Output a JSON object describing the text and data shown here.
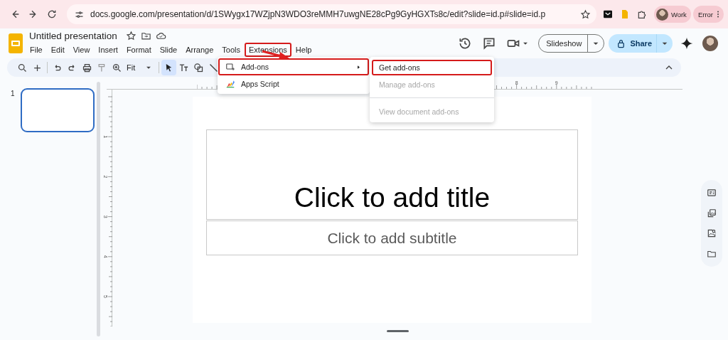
{
  "browser": {
    "url": "docs.google.com/presentation/d/1SWygx17WZjpN3WDO3reMMH7uwgNE28cPg9GyHGXTs8c/edit?slide=id.p#slide=id.p",
    "profile": "Work",
    "error_chip": "Error"
  },
  "document": {
    "title": "Untitled presentation"
  },
  "menu_bar": [
    {
      "label": "File",
      "highlighted": false
    },
    {
      "label": "Edit",
      "highlighted": false
    },
    {
      "label": "View",
      "highlighted": false
    },
    {
      "label": "Insert",
      "highlighted": false
    },
    {
      "label": "Format",
      "highlighted": false
    },
    {
      "label": "Slide",
      "highlighted": false
    },
    {
      "label": "Arrange",
      "highlighted": false
    },
    {
      "label": "Tools",
      "highlighted": false
    },
    {
      "label": "Extensions",
      "highlighted": true
    },
    {
      "label": "Help",
      "highlighted": false
    }
  ],
  "toolbar": {
    "zoom": "Fit",
    "tools": [
      {
        "kind": "select",
        "selected": true
      },
      {
        "kind": "text",
        "selected": false
      },
      {
        "kind": "shape",
        "selected": false
      },
      {
        "kind": "line",
        "selected": false
      }
    ]
  },
  "actions": {
    "slideshow": "Slideshow",
    "share": "Share"
  },
  "extensions_menu": [
    {
      "label": "Add-ons",
      "has_submenu": true,
      "highlighted": true
    },
    {
      "label": "Apps Script",
      "has_submenu": false,
      "highlighted": false
    }
  ],
  "addons_submenu": [
    [
      {
        "label": "Get add-ons",
        "disabled": false,
        "highlighted": true
      },
      {
        "label": "Manage add-ons",
        "disabled": true,
        "highlighted": false
      }
    ],
    [
      {
        "label": "View document add-ons",
        "disabled": true,
        "highlighted": false
      }
    ]
  ],
  "filmstrip": [
    {
      "number": "1",
      "selected": true
    }
  ],
  "rulers": {
    "horizontal": [
      "8",
      "9"
    ],
    "vertical": [
      "1",
      "2",
      "3",
      "4",
      "5"
    ]
  },
  "slide": {
    "title_placeholder": "Click to add title",
    "subtitle_placeholder": "Click to add subtitle"
  }
}
